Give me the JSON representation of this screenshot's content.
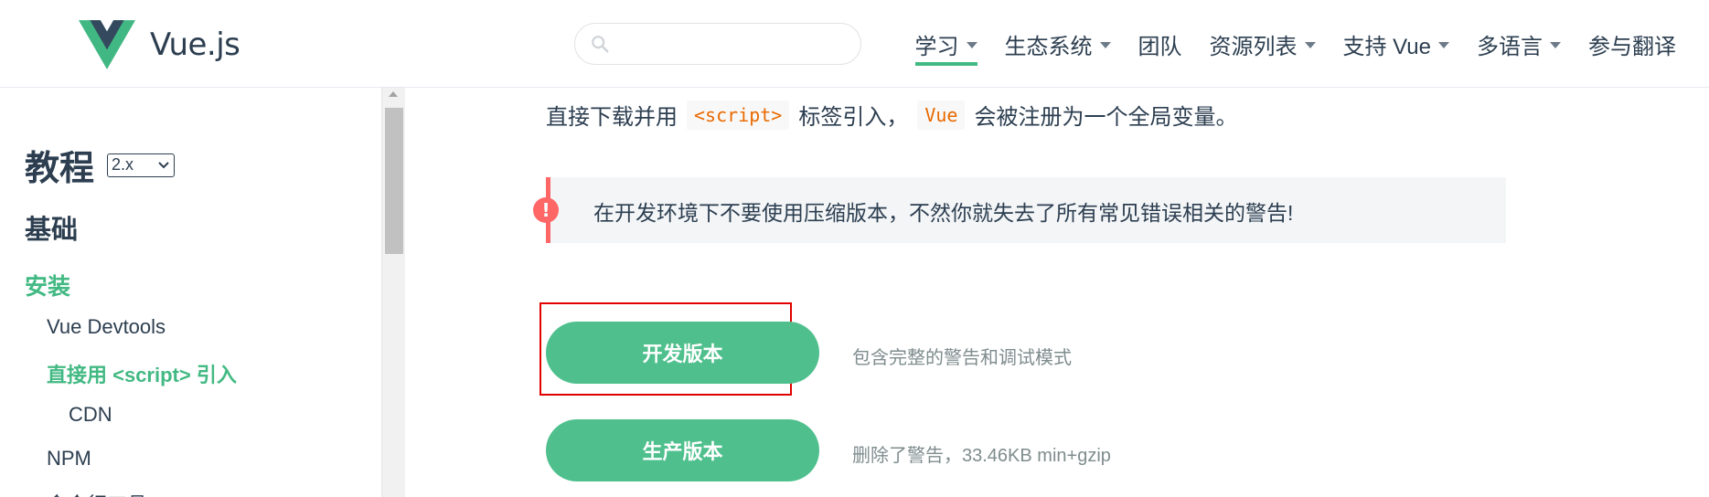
{
  "header": {
    "logo_text": "Vue.js",
    "search_placeholder": "",
    "nav": [
      {
        "label": "学习",
        "dropdown": true,
        "active": true
      },
      {
        "label": "生态系统",
        "dropdown": true
      },
      {
        "label": "团队",
        "dropdown": false
      },
      {
        "label": "资源列表",
        "dropdown": true
      },
      {
        "label": "支持 Vue",
        "dropdown": true
      },
      {
        "label": "多语言",
        "dropdown": true
      },
      {
        "label": "参与翻译",
        "dropdown": false
      }
    ]
  },
  "sidebar": {
    "title": "教程",
    "version": "2.x",
    "section": "基础",
    "items": [
      {
        "label": "安装"
      },
      {
        "label": "Vue Devtools"
      },
      {
        "label": "直接用 <script> 引入"
      },
      {
        "label": "CDN"
      },
      {
        "label": "NPM"
      },
      {
        "label": "命令行工具"
      }
    ]
  },
  "main": {
    "intro_prefix": "直接下载并用",
    "intro_code1": "<script>",
    "intro_mid": "标签引入，",
    "intro_code2": "Vue",
    "intro_suffix": "会被注册为一个全局变量。",
    "warning": "在开发环境下不要使用压缩版本，不然你就失去了所有常见错误相关的警告!",
    "warning_icon": "!",
    "downloads": [
      {
        "label": "开发版本",
        "desc": "包含完整的警告和调试模式"
      },
      {
        "label": "生产版本",
        "desc": "删除了警告，33.46KB min+gzip"
      }
    ]
  },
  "colors": {
    "accent": "#42b983",
    "button": "#4fc08d",
    "text": "#2c3e50",
    "warning": "#ff6666",
    "highlight_frame": "#e00000"
  }
}
